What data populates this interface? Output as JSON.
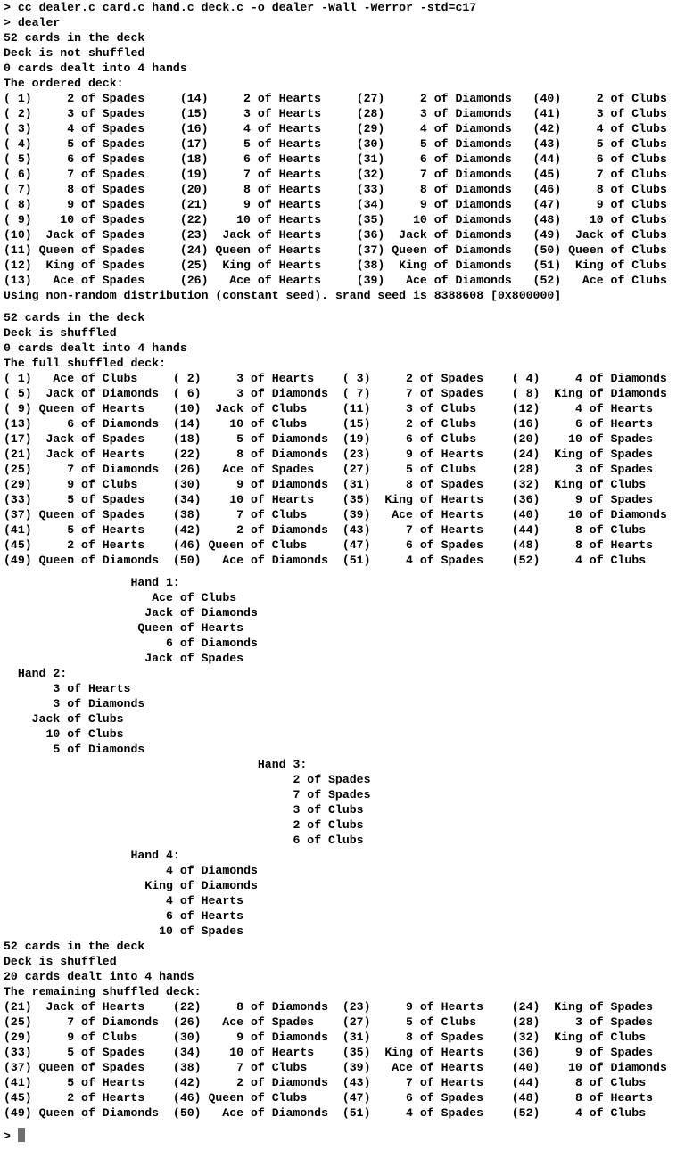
{
  "terminal": {
    "prompt": ">",
    "commands": [
      "cc dealer.c card.c hand.c deck.c -o dealer -Wall -Werror -std=c17",
      "dealer"
    ],
    "cursor_color": "#6e6e6e",
    "section1": {
      "status": [
        "52 cards in the deck",
        "Deck is not shuffled",
        "0 cards dealt into 4 hands"
      ],
      "heading": "The ordered deck:",
      "cards": [
        [
          "( 1)",
          "2 of Spades"
        ],
        [
          "( 2)",
          "3 of Spades"
        ],
        [
          "( 3)",
          "4 of Spades"
        ],
        [
          "( 4)",
          "5 of Spades"
        ],
        [
          "( 5)",
          "6 of Spades"
        ],
        [
          "( 6)",
          "7 of Spades"
        ],
        [
          "( 7)",
          "8 of Spades"
        ],
        [
          "( 8)",
          "9 of Spades"
        ],
        [
          "( 9)",
          "10 of Spades"
        ],
        [
          "(10)",
          "Jack of Spades"
        ],
        [
          "(11)",
          "Queen of Spades"
        ],
        [
          "(12)",
          "King of Spades"
        ],
        [
          "(13)",
          "Ace of Spades"
        ],
        [
          "(14)",
          "2 of Hearts"
        ],
        [
          "(15)",
          "3 of Hearts"
        ],
        [
          "(16)",
          "4 of Hearts"
        ],
        [
          "(17)",
          "5 of Hearts"
        ],
        [
          "(18)",
          "6 of Hearts"
        ],
        [
          "(19)",
          "7 of Hearts"
        ],
        [
          "(20)",
          "8 of Hearts"
        ],
        [
          "(21)",
          "9 of Hearts"
        ],
        [
          "(22)",
          "10 of Hearts"
        ],
        [
          "(23)",
          "Jack of Hearts"
        ],
        [
          "(24)",
          "Queen of Hearts"
        ],
        [
          "(25)",
          "King of Hearts"
        ],
        [
          "(26)",
          "Ace of Hearts"
        ],
        [
          "(27)",
          "2 of Diamonds"
        ],
        [
          "(28)",
          "3 of Diamonds"
        ],
        [
          "(29)",
          "4 of Diamonds"
        ],
        [
          "(30)",
          "5 of Diamonds"
        ],
        [
          "(31)",
          "6 of Diamonds"
        ],
        [
          "(32)",
          "7 of Diamonds"
        ],
        [
          "(33)",
          "8 of Diamonds"
        ],
        [
          "(34)",
          "9 of Diamonds"
        ],
        [
          "(35)",
          "10 of Diamonds"
        ],
        [
          "(36)",
          "Jack of Diamonds"
        ],
        [
          "(37)",
          "Queen of Diamonds"
        ],
        [
          "(38)",
          "King of Diamonds"
        ],
        [
          "(39)",
          "Ace of Diamonds"
        ],
        [
          "(40)",
          "2 of Clubs"
        ],
        [
          "(41)",
          "3 of Clubs"
        ],
        [
          "(42)",
          "4 of Clubs"
        ],
        [
          "(43)",
          "5 of Clubs"
        ],
        [
          "(44)",
          "6 of Clubs"
        ],
        [
          "(45)",
          "7 of Clubs"
        ],
        [
          "(46)",
          "8 of Clubs"
        ],
        [
          "(47)",
          "9 of Clubs"
        ],
        [
          "(48)",
          "10 of Clubs"
        ],
        [
          "(49)",
          "Jack of Clubs"
        ],
        [
          "(50)",
          "Queen of Clubs"
        ],
        [
          "(51)",
          "King of Clubs"
        ],
        [
          "(52)",
          "Ace of Clubs"
        ]
      ],
      "seed_message": "Using non-random distribution (constant seed). srand seed is 8388608 [0x800000]"
    },
    "section2": {
      "status": [
        "52 cards in the deck",
        "Deck is shuffled",
        "0 cards dealt into 4 hands"
      ],
      "heading": "The full shuffled deck:",
      "cards": [
        [
          "( 1)",
          "Ace of Clubs"
        ],
        [
          "( 2)",
          "3 of Hearts"
        ],
        [
          "( 3)",
          "2 of Spades"
        ],
        [
          "( 4)",
          "4 of Diamonds"
        ],
        [
          "( 5)",
          "Jack of Diamonds"
        ],
        [
          "( 6)",
          "3 of Diamonds"
        ],
        [
          "( 7)",
          "7 of Spades"
        ],
        [
          "( 8)",
          "King of Diamonds"
        ],
        [
          "( 9)",
          "Queen of Hearts"
        ],
        [
          "(10)",
          "Jack of Clubs"
        ],
        [
          "(11)",
          "3 of Clubs"
        ],
        [
          "(12)",
          "4 of Hearts"
        ],
        [
          "(13)",
          "6 of Diamonds"
        ],
        [
          "(14)",
          "10 of Clubs"
        ],
        [
          "(15)",
          "2 of Clubs"
        ],
        [
          "(16)",
          "6 of Hearts"
        ],
        [
          "(17)",
          "Jack of Spades"
        ],
        [
          "(18)",
          "5 of Diamonds"
        ],
        [
          "(19)",
          "6 of Clubs"
        ],
        [
          "(20)",
          "10 of Spades"
        ],
        [
          "(21)",
          "Jack of Hearts"
        ],
        [
          "(22)",
          "8 of Diamonds"
        ],
        [
          "(23)",
          "9 of Hearts"
        ],
        [
          "(24)",
          "King of Spades"
        ],
        [
          "(25)",
          "7 of Diamonds"
        ],
        [
          "(26)",
          "Ace of Spades"
        ],
        [
          "(27)",
          "5 of Clubs"
        ],
        [
          "(28)",
          "3 of Spades"
        ],
        [
          "(29)",
          "9 of Clubs"
        ],
        [
          "(30)",
          "9 of Diamonds"
        ],
        [
          "(31)",
          "8 of Spades"
        ],
        [
          "(32)",
          "King of Clubs"
        ],
        [
          "(33)",
          "5 of Spades"
        ],
        [
          "(34)",
          "10 of Hearts"
        ],
        [
          "(35)",
          "King of Hearts"
        ],
        [
          "(36)",
          "9 of Spades"
        ],
        [
          "(37)",
          "Queen of Spades"
        ],
        [
          "(38)",
          "7 of Clubs"
        ],
        [
          "(39)",
          "Ace of Hearts"
        ],
        [
          "(40)",
          "10 of Diamonds"
        ],
        [
          "(41)",
          "5 of Hearts"
        ],
        [
          "(42)",
          "2 of Diamonds"
        ],
        [
          "(43)",
          "7 of Hearts"
        ],
        [
          "(44)",
          "8 of Clubs"
        ],
        [
          "(45)",
          "2 of Hearts"
        ],
        [
          "(46)",
          "Queen of Clubs"
        ],
        [
          "(47)",
          "6 of Spades"
        ],
        [
          "(48)",
          "8 of Hearts"
        ],
        [
          "(49)",
          "Queen of Diamonds"
        ],
        [
          "(50)",
          "Ace of Diamonds"
        ],
        [
          "(51)",
          "4 of Spades"
        ],
        [
          "(52)",
          "4 of Clubs"
        ]
      ]
    },
    "hands": [
      {
        "title": "Hand 1:",
        "cards": [
          "Ace of Clubs",
          "Jack of Diamonds",
          "Queen of Hearts",
          "6 of Diamonds",
          "Jack of Spades"
        ]
      },
      {
        "title": "Hand 2:",
        "cards": [
          "3 of Hearts",
          "3 of Diamonds",
          "Jack of Clubs",
          "10 of Clubs",
          "5 of Diamonds"
        ]
      },
      {
        "title": "Hand 3:",
        "cards": [
          "2 of Spades",
          "7 of Spades",
          "3 of Clubs",
          "2 of Clubs",
          "6 of Clubs"
        ]
      },
      {
        "title": "Hand 4:",
        "cards": [
          "4 of Diamonds",
          "King of Diamonds",
          "4 of Hearts",
          "6 of Hearts",
          "10 of Spades"
        ]
      }
    ],
    "section3": {
      "status": [
        "52 cards in the deck",
        "Deck is shuffled",
        "20 cards dealt into 4 hands"
      ],
      "heading": "The remaining shuffled deck:",
      "cards": [
        [
          "(21)",
          "Jack of Hearts"
        ],
        [
          "(22)",
          "8 of Diamonds"
        ],
        [
          "(23)",
          "9 of Hearts"
        ],
        [
          "(24)",
          "King of Spades"
        ],
        [
          "(25)",
          "7 of Diamonds"
        ],
        [
          "(26)",
          "Ace of Spades"
        ],
        [
          "(27)",
          "5 of Clubs"
        ],
        [
          "(28)",
          "3 of Spades"
        ],
        [
          "(29)",
          "9 of Clubs"
        ],
        [
          "(30)",
          "9 of Diamonds"
        ],
        [
          "(31)",
          "8 of Spades"
        ],
        [
          "(32)",
          "King of Clubs"
        ],
        [
          "(33)",
          "5 of Spades"
        ],
        [
          "(34)",
          "10 of Hearts"
        ],
        [
          "(35)",
          "King of Hearts"
        ],
        [
          "(36)",
          "9 of Spades"
        ],
        [
          "(37)",
          "Queen of Spades"
        ],
        [
          "(38)",
          "7 of Clubs"
        ],
        [
          "(39)",
          "Ace of Hearts"
        ],
        [
          "(40)",
          "10 of Diamonds"
        ],
        [
          "(41)",
          "5 of Hearts"
        ],
        [
          "(42)",
          "2 of Diamonds"
        ],
        [
          "(43)",
          "7 of Hearts"
        ],
        [
          "(44)",
          "8 of Clubs"
        ],
        [
          "(45)",
          "2 of Hearts"
        ],
        [
          "(46)",
          "Queen of Clubs"
        ],
        [
          "(47)",
          "6 of Spades"
        ],
        [
          "(48)",
          "8 of Hearts"
        ],
        [
          "(49)",
          "Queen of Diamonds"
        ],
        [
          "(50)",
          "Ace of Diamonds"
        ],
        [
          "(51)",
          "4 of Spades"
        ],
        [
          "(52)",
          "4 of Clubs"
        ]
      ]
    }
  }
}
